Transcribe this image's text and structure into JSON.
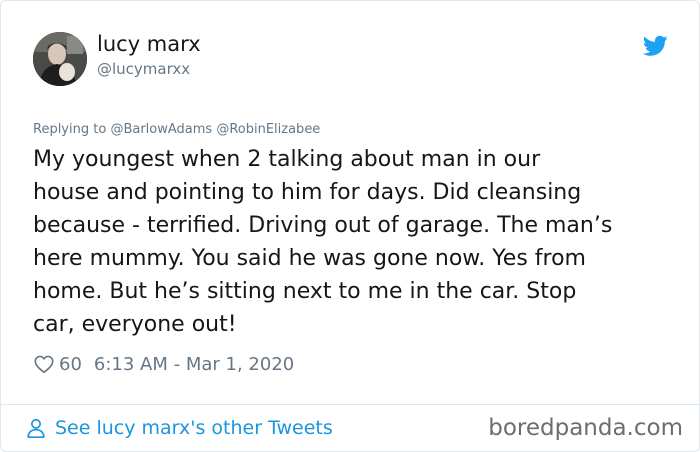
{
  "author": {
    "name": "lucy marx",
    "handle": "@lucymarxx",
    "avatar_icon": "profile-photo"
  },
  "platform_icon": "twitter-bird-icon",
  "colors": {
    "brand_blue": "#1b95e0",
    "text_primary": "#14171a",
    "text_secondary": "#657786",
    "border": "#e1e8ed"
  },
  "reply": {
    "prefix": "Replying to ",
    "mention_1": "@BarlowAdams",
    "mention_2": "@RobinElizabee"
  },
  "tweet": {
    "text": "My youngest when 2  talking about man in our\nhouse and pointing to him for days. Did cleansing\nbecause - terrified. Driving out of garage. The man’s\nhere mummy. You said he was gone now. Yes from\nhome. But he’s sitting next to me in the car.  Stop\ncar, everyone out!",
    "likes": "60",
    "timestamp": "6:13 AM - Mar 1, 2020"
  },
  "footer": {
    "see_more": "See lucy marx's other Tweets",
    "watermark": "boredpanda.com"
  }
}
